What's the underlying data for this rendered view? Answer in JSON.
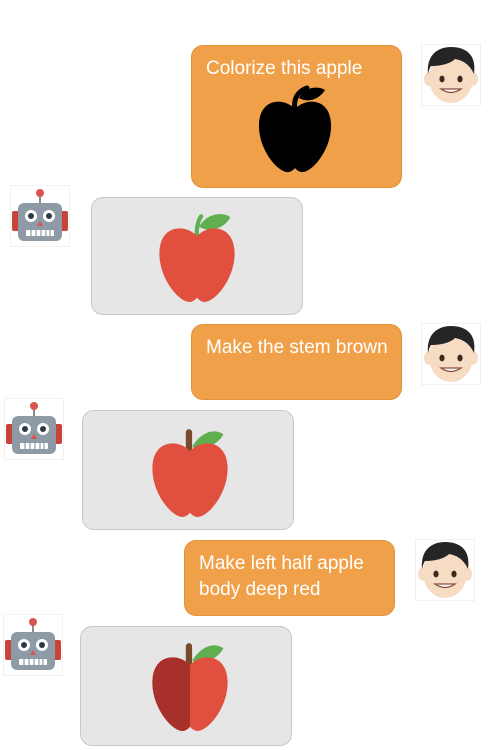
{
  "conversation": {
    "messages": [
      {
        "role": "user",
        "text": "Colorize this apple",
        "image": "black-apple-silhouette"
      },
      {
        "role": "assistant",
        "image": "red-apple-green-stem"
      },
      {
        "role": "user",
        "text": "Make the stem brown"
      },
      {
        "role": "assistant",
        "image": "red-apple-brown-stem"
      },
      {
        "role": "user",
        "text": "Make left half apple body deep red"
      },
      {
        "role": "assistant",
        "image": "two-tone-red-apple"
      }
    ]
  },
  "icons": {
    "user_avatar": "boy-face-icon",
    "bot_avatar": "robot-face-icon"
  },
  "colors": {
    "user_bubble": "#F0A048",
    "bot_bubble": "#E6E6E6",
    "apple_red": "#E1503F",
    "apple_deep_red": "#A8302B",
    "leaf_green": "#5FAE4F",
    "stem_brown": "#7A4A2C"
  }
}
